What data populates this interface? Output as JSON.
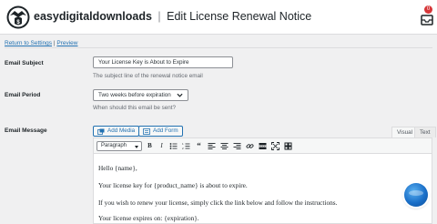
{
  "header": {
    "brand_part1": "easy",
    "brand_part2": "digital",
    "brand_part3": "downloads",
    "separator": "|",
    "page_title": "Edit License Renewal Notice",
    "notification_count": "0"
  },
  "links": {
    "return_label": "Return to Settings",
    "separator": "|",
    "preview_label": "Preview"
  },
  "form": {
    "subject": {
      "label": "Email Subject",
      "value": "Your License Key is About to Expire",
      "description": "The subject line of the renewal notice email"
    },
    "period": {
      "label": "Email Period",
      "selected": "Two weeks before expiration",
      "description": "When should this email be sent?"
    },
    "message": {
      "label": "Email Message",
      "add_media_label": "Add Media",
      "add_form_label": "Add Form",
      "tab_visual": "Visual",
      "tab_text": "Text",
      "format_selected": "Paragraph",
      "toolbar_icons": [
        "bold-icon",
        "italic-icon",
        "bulleted-list-icon",
        "numbered-list-icon",
        "blockquote-icon",
        "align-left-icon",
        "align-center-icon",
        "align-right-icon",
        "link-icon",
        "read-more-icon",
        "fullscreen-icon",
        "toolbar-toggle-icon"
      ],
      "lines": [
        "Hello {name},",
        "Your license key for {product_name} is about to expire.",
        "If you wish to renew your license, simply click the link below and follow the instructions.",
        "Your license expires on: {expiration}."
      ]
    }
  },
  "colors": {
    "accent": "#2271b1",
    "badge": "#d63638"
  }
}
